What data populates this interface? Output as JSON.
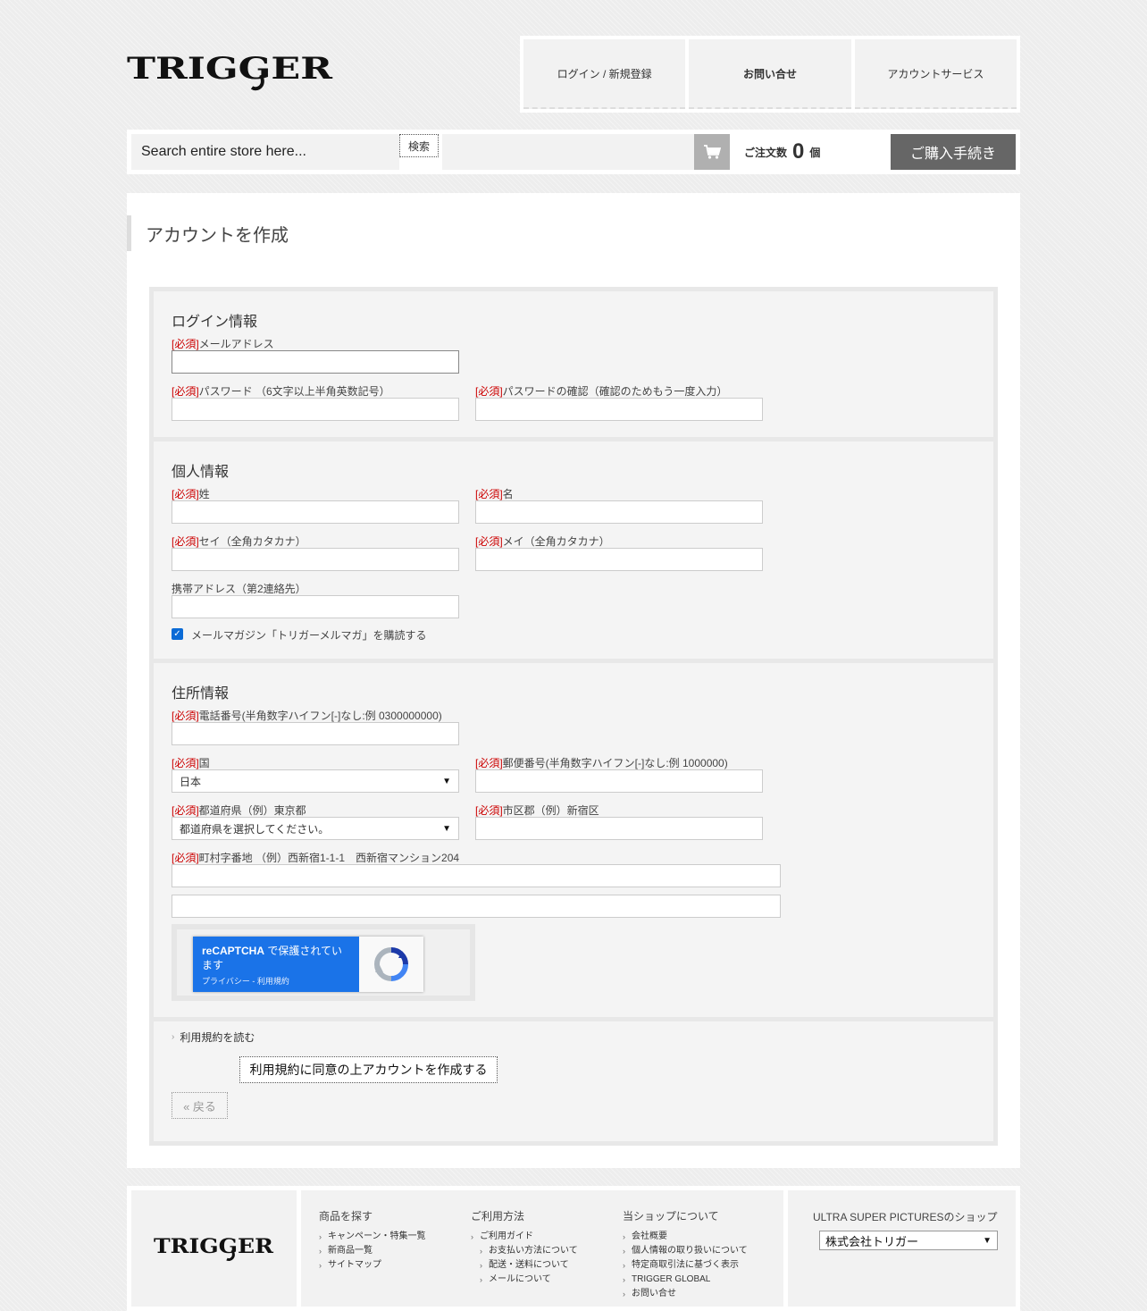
{
  "header": {
    "logo_text": "TRIGGER",
    "nav": [
      {
        "label": "ログイン / 新規登録"
      },
      {
        "label": "お問い合せ"
      },
      {
        "label": "アカウントサービス"
      }
    ]
  },
  "search": {
    "placeholder": "Search entire store here...",
    "button_label": "検索"
  },
  "cart": {
    "label": "ご注文数",
    "count": "0",
    "unit": "個",
    "checkout_label": "ご購入手続き"
  },
  "page": {
    "title": "アカウントを作成"
  },
  "form": {
    "required_mark": "[必須]",
    "login": {
      "legend": "ログイン情報",
      "email_label": "メールアドレス",
      "password_label": "パスワード （6文字以上半角英数記号）",
      "password_confirm_label": "パスワードの確認（確認のためもう一度入力）"
    },
    "personal": {
      "legend": "個人情報",
      "last_name_label": "姓",
      "first_name_label": "名",
      "last_name_kana_label": "セイ（全角カタカナ）",
      "first_name_kana_label": "メイ（全角カタカナ）",
      "mobile_email_label": "携帯アドレス（第2連絡先）",
      "newsletter_label": "メールマガジン「トリガーメルマガ」を購読する",
      "newsletter_checked": true
    },
    "address": {
      "legend": "住所情報",
      "phone_label": "電話番号(半角数字ハイフン[-]なし:例 0300000000)",
      "country_label": "国",
      "country_value": "日本",
      "postcode_label": "郵便番号(半角数字ハイフン[-]なし:例 1000000)",
      "prefecture_label": "都道府県（例）東京都",
      "prefecture_value": "都道府県を選択してください。",
      "city_label": "市区郡（例）新宿区",
      "street_label": "町村字番地 （例）西新宿1-1-1　西新宿マンション204"
    },
    "captcha": {
      "brand": "reCAPTCHA",
      "text": " で保護されています",
      "links": "プライバシー - 利用規約"
    },
    "terms_link": "利用規約を読む",
    "submit_label": "利用規約に同意の上アカウントを作成する",
    "back_label": "« 戻る"
  },
  "footer": {
    "logo_text": "TRIGGER",
    "cols": [
      {
        "title": "商品を探す",
        "items": [
          "キャンペーン・特集一覧",
          "新商品一覧",
          "サイトマップ"
        ]
      },
      {
        "title": "ご利用方法",
        "items": [
          "ご利用ガイド",
          "お支払い方法について",
          "配送・送料について",
          "メールについて"
        ]
      },
      {
        "title": "当ショップについて",
        "items": [
          "会社概要",
          "個人情報の取り扱いについて",
          "特定商取引法に基づく表示",
          "TRIGGER GLOBAL",
          "お問い合せ"
        ]
      }
    ],
    "shop_title": "ULTRA SUPER PICTURESのショップ",
    "shop_select_value": "株式会社トリガー"
  }
}
